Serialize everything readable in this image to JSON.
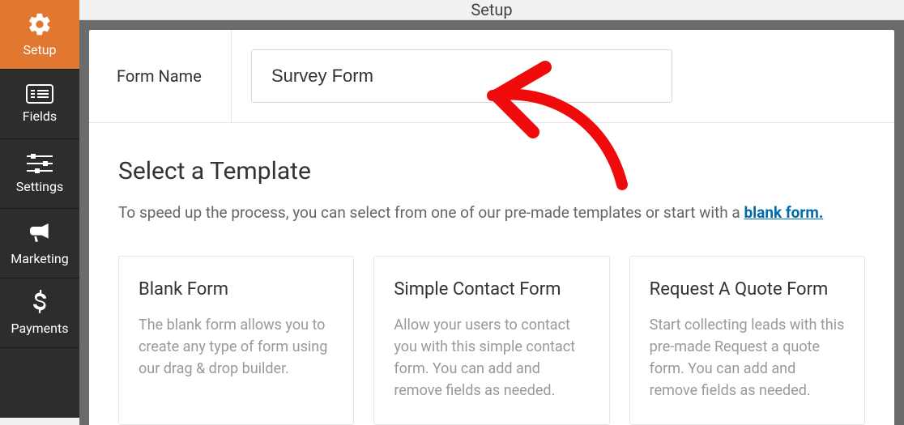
{
  "sidebar": {
    "items": [
      {
        "label": "Setup"
      },
      {
        "label": "Fields"
      },
      {
        "label": "Settings"
      },
      {
        "label": "Marketing"
      },
      {
        "label": "Payments"
      }
    ]
  },
  "topbar": {
    "title": "Setup"
  },
  "form_name": {
    "label": "Form Name",
    "value": "Survey Form"
  },
  "templates": {
    "heading": "Select a Template",
    "subtext_prefix": "To speed up the process, you can select from one of our pre-made templates or start with a ",
    "subtext_link": "blank form.",
    "cards": [
      {
        "title": "Blank Form",
        "desc": "The blank form allows you to create any type of form using our drag & drop builder."
      },
      {
        "title": "Simple Contact Form",
        "desc": "Allow your users to contact you with this simple contact form. You can add and remove fields as needed."
      },
      {
        "title": "Request A Quote Form",
        "desc": "Start collecting leads with this pre-made Request a quote form. You can add and remove fields as needed."
      }
    ]
  }
}
